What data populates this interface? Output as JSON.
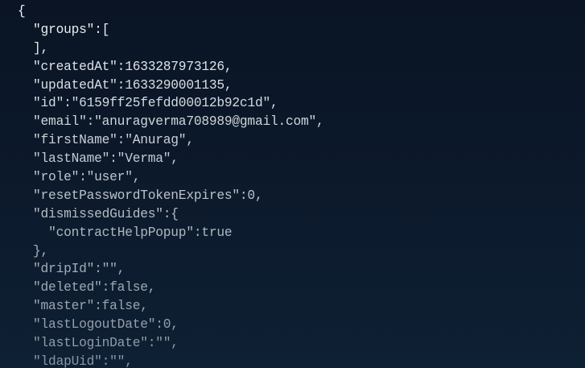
{
  "colors": {
    "background_top": "#0a1424",
    "background_bottom": "#0e2034",
    "text_top": "#eef2f6",
    "text_bottom": "#8b96a2"
  },
  "json_viewer": {
    "lines": [
      {
        "indent": "",
        "text": "{"
      },
      {
        "indent": "  ",
        "text": "\"groups\":["
      },
      {
        "indent": "  ",
        "text": "],"
      },
      {
        "indent": "  ",
        "text": "\"createdAt\":1633287973126,"
      },
      {
        "indent": "  ",
        "text": "\"updatedAt\":1633290001135,"
      },
      {
        "indent": "  ",
        "text": "\"id\":\"6159ff25fefdd00012b92c1d\","
      },
      {
        "indent": "  ",
        "text": "\"email\":\"anuragverma708989@gmail.com\","
      },
      {
        "indent": "  ",
        "text": "\"firstName\":\"Anurag\","
      },
      {
        "indent": "  ",
        "text": "\"lastName\":\"Verma\","
      },
      {
        "indent": "  ",
        "text": "\"role\":\"user\","
      },
      {
        "indent": "  ",
        "text": "\"resetPasswordTokenExpires\":0,"
      },
      {
        "indent": "  ",
        "text": "\"dismissedGuides\":{"
      },
      {
        "indent": "    ",
        "text": "\"contractHelpPopup\":true"
      },
      {
        "indent": "  ",
        "text": "},"
      },
      {
        "indent": "  ",
        "text": "\"dripId\":\"\","
      },
      {
        "indent": "  ",
        "text": "\"deleted\":false,"
      },
      {
        "indent": "  ",
        "text": "\"master\":false,"
      },
      {
        "indent": "  ",
        "text": "\"lastLogoutDate\":0,"
      },
      {
        "indent": "  ",
        "text": "\"lastLoginDate\":\"\","
      },
      {
        "indent": "  ",
        "text": "\"ldapUid\":\"\","
      }
    ]
  }
}
